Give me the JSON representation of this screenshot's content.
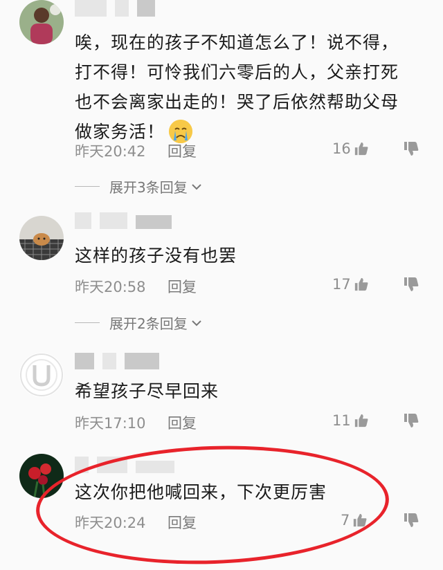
{
  "comments": [
    {
      "text": "唉，现在的孩子不知道怎么了！说不得，打不得！可怜我们六零后的人，父亲打死也不会离家出走的！哭了后依然帮助父母做家务活！",
      "time": "昨天20:42",
      "reply_label": "回复",
      "likes": "16",
      "expand_label": "展开3条回复"
    },
    {
      "text": "这样的孩子没有也罢",
      "time": "昨天20:58",
      "reply_label": "回复",
      "likes": "17",
      "expand_label": "展开2条回复"
    },
    {
      "text": "希望孩子尽早回来",
      "time": "昨天17:10",
      "reply_label": "回复",
      "likes": "11"
    },
    {
      "text": "这次你把他喊回来，下次更厉害",
      "time": "昨天20:24",
      "reply_label": "回复",
      "likes": "7"
    }
  ],
  "icons": {
    "like": "thumbs-up-icon",
    "dislike": "thumbs-down-icon",
    "expand": "chevron-down-icon",
    "emoji": "crying-face-emoji"
  },
  "colors": {
    "highlight": "#e8232b",
    "meta_text": "#8e8e8e"
  }
}
